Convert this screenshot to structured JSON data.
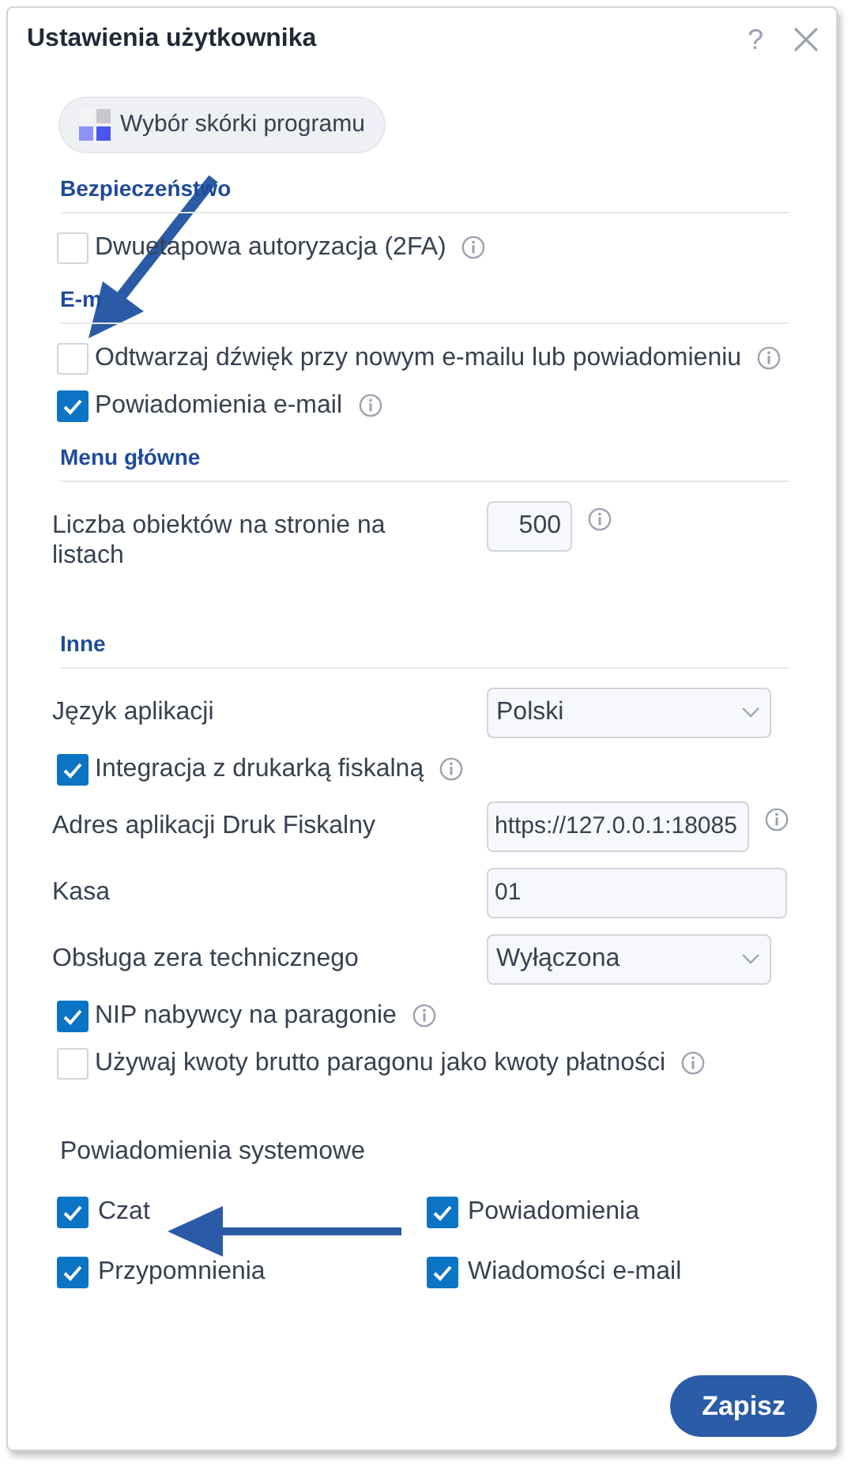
{
  "window": {
    "title": "Ustawienia użytkownika",
    "help": "?"
  },
  "skin_button": {
    "label": "Wybór skórki programu"
  },
  "sections": [
    {
      "title": "Bezpieczeństwo",
      "items": [
        {
          "kind": "checkbox",
          "label": "Dwuetapowa autoryzacja (2FA)",
          "checked": false,
          "info": true
        }
      ]
    },
    {
      "title": "E-m",
      "items": [
        {
          "kind": "checkbox",
          "label": "Odtwarzaj dźwięk przy nowym e-mailu lub powiadomieniu",
          "checked": false,
          "info": true
        },
        {
          "kind": "checkbox",
          "label": "Powiadomienia e-mail",
          "checked": true,
          "info": true
        }
      ]
    },
    {
      "title": "Menu główne",
      "items": [
        {
          "kind": "number",
          "label": "Liczba obiektów na stronie na listach",
          "value": "500",
          "info": true
        }
      ]
    },
    {
      "title": "Inne",
      "items": [
        {
          "kind": "select",
          "label": "Język aplikacji",
          "value": "Polski",
          "info": false
        },
        {
          "kind": "checkbox",
          "label": "Integracja z drukarką fiskalną",
          "checked": true,
          "info": true
        },
        {
          "kind": "text",
          "label": "Adres aplikacji Druk Fiskalny",
          "value": "https://127.0.0.1:18085",
          "info": true
        },
        {
          "kind": "text",
          "label": "Kasa",
          "value": "01",
          "info": false
        },
        {
          "kind": "select",
          "label": "Obsługa zera technicznego",
          "value": "Wyłączona",
          "info": false
        },
        {
          "kind": "checkbox",
          "label": "NIP nabywcy na paragonie",
          "checked": true,
          "info": true
        },
        {
          "kind": "checkbox",
          "label": "Używaj kwoty brutto paragonu jako kwoty płatności",
          "checked": false,
          "info": true
        }
      ]
    }
  ],
  "system_notifications": {
    "title": "Powiadomienia systemowe",
    "options": [
      {
        "label": "Czat",
        "checked": true
      },
      {
        "label": "Powiadomienia",
        "checked": true
      },
      {
        "label": "Przypomnienia",
        "checked": true
      },
      {
        "label": "Wiadomości e-mail",
        "checked": true
      }
    ]
  },
  "save_button": {
    "label": "Zapisz"
  }
}
